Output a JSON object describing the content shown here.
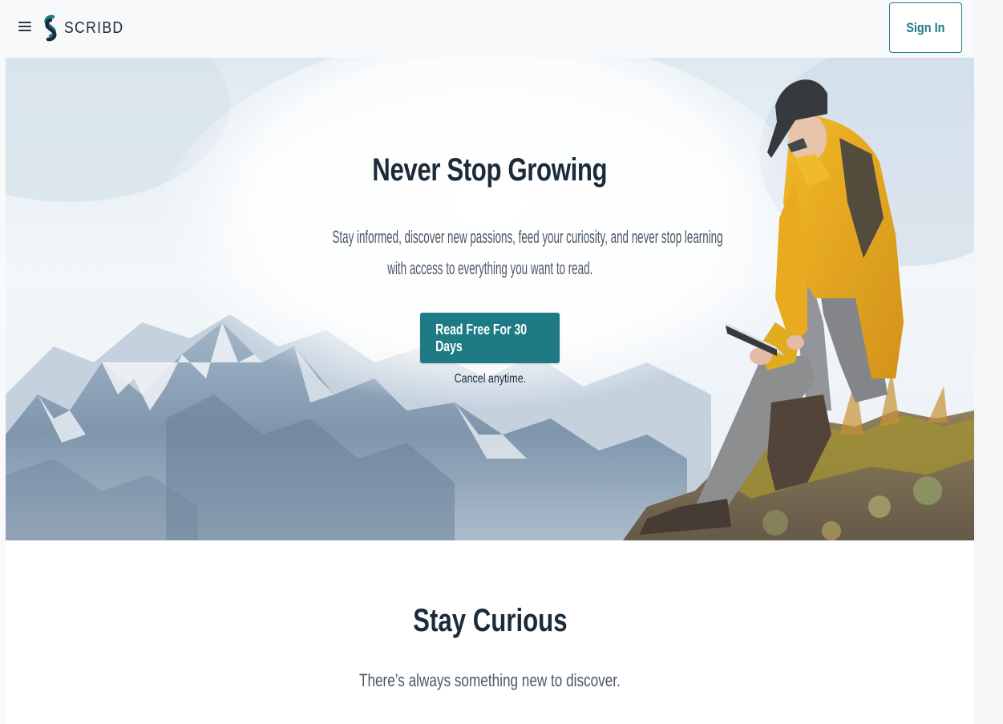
{
  "header": {
    "menu_icon": "hamburger-menu-icon",
    "logo_icon": "scribd-logo-icon",
    "logo_text": "SCRIBD",
    "signin_label": "Sign In"
  },
  "hero": {
    "title": "Never Stop Growing",
    "subtitle_line1": "Stay informed, discover new passions, feed your curiosity, and never stop learning",
    "subtitle_line2": "with access to everything you want to read.",
    "cta_label": "Read Free For 30 Days",
    "cancel_note": "Cancel anytime."
  },
  "section": {
    "title": "Stay Curious",
    "subtitle": "There’s always something new to discover."
  },
  "colors": {
    "accent": "#1e7b85",
    "heading": "#1c2b39",
    "body_text": "#4a5866"
  }
}
